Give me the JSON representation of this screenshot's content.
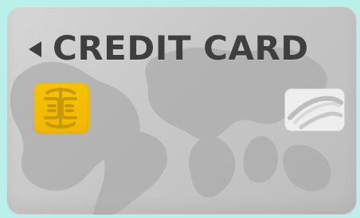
{
  "card": {
    "title": "CREDIT CARD"
  },
  "colors": {
    "background": "#b9f0ea",
    "card": "#c9c9c9",
    "map": "#a9a9a9",
    "text": "#3f3f3f",
    "chip": "#f2bc00",
    "chip_lines": "#c99a00",
    "hologram": "#eeeeee"
  },
  "icons": {
    "arrow": "left-triangle-icon",
    "chip": "chip-icon",
    "hologram": "hologram-icon"
  }
}
